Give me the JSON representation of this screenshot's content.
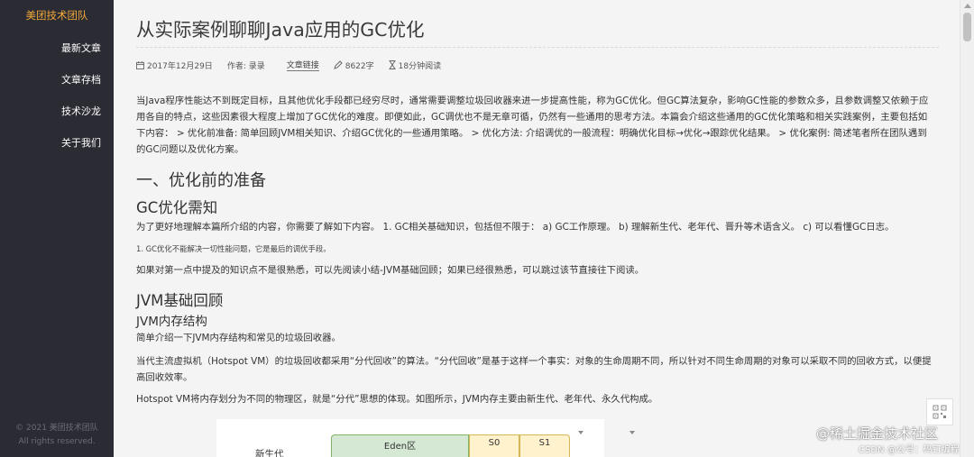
{
  "sidebar": {
    "brand": "美团技术团队",
    "items": [
      {
        "label": "最新文章"
      },
      {
        "label": "文章存档"
      },
      {
        "label": "技术沙龙"
      },
      {
        "label": "关于我们"
      }
    ],
    "copyright_line1": "© 2021 美团技术团队",
    "copyright_line2": "All rights reserved."
  },
  "article": {
    "title": "从实际案例聊聊Java应用的GC优化",
    "meta": {
      "date": "2017年12月29日",
      "author": "作者: 录录",
      "link": "文章链接",
      "word_count": "8622字",
      "read_time": "18分钟阅读"
    },
    "intro": "当Java程序性能达不到既定目标，且其他优化手段都已经穷尽时，通常需要调整垃圾回收器来进一步提高性能，称为GC优化。但GC算法复杂，影响GC性能的参数众多，且参数调整又依赖于应用各自的特点，这些因素很大程度上增加了GC优化的难度。即便如此，GC调优也不是无章可循，仍然有一些通用的思考方法。本篇会介绍这些通用的GC优化策略和相关实践案例，主要包括如下内容： > 优化前准备: 简单回顾JVM相关知识、介绍GC优化的一些通用策略。 > 优化方法: 介绍调优的一般流程：明确优化目标→优化→跟踪优化结果。 > 优化案例: 简述笔者所在团队遇到的GC问题以及优化方案。",
    "h_prepare": "一、优化前的准备",
    "h_gc_know": "GC优化需知",
    "p_need": "为了更好地理解本篇所介绍的内容，你需要了解如下内容。 1. GC相关基础知识，包括但不限于： a) GC工作原理。 b) 理解新生代、老年代、晋升等术语含义。 c) 可以看懂GC日志。",
    "note": "1. GC优化不能解决一切性能问题，它是最后的调优手段。",
    "p_skip": "如果对第一点中提及的知识点不是很熟悉，可以先阅读小结-JVM基础回顾；如果已经很熟悉，可以跳过该节直接往下阅读。",
    "h_jvm_review": "JVM基础回顾",
    "h_jvm_mem": "JVM内存结构",
    "p_brief": "简单介绍一下JVM内存结构和常见的垃圾回收器。",
    "p_hotspot": "当代主流虚拟机（Hotspot VM）的垃圾回收都采用“分代回收”的算法。“分代回收”是基于这样一个事实：对象的生命周期不同，所以针对不同生命周期的对象可以采取不同的回收方式，以便提高回收效率。",
    "p_areas": "Hotspot VM将内存划分为不同的物理区，就是“分代”思想的体现。如图所示，JVM内存主要由新生代、老年代、永久代构成。",
    "diagram": {
      "young_label": "新生代",
      "eden": "Eden区",
      "s0": "S0",
      "s1": "S1"
    }
  },
  "watermark": {
    "main": "@稀土掘金技术社区",
    "sub": "CSDN @公号：码钉编程"
  },
  "icons": [
    "calendar-icon",
    "pencil-icon",
    "hourglass-icon",
    "qr-code-icon"
  ]
}
